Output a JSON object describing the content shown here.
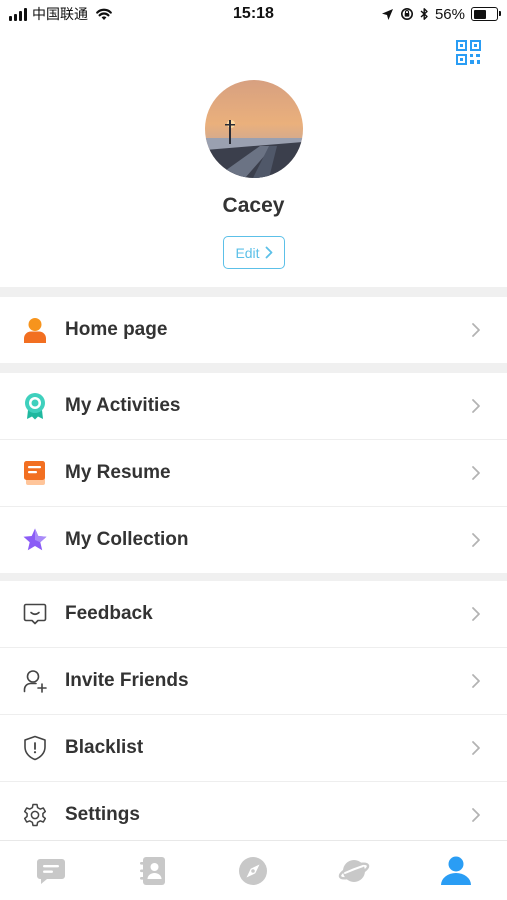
{
  "status_bar": {
    "carrier": "中国联通",
    "time": "15:18",
    "battery_percent": "56%",
    "battery_level": 0.56,
    "icons": [
      "signal-icon",
      "wifi-icon",
      "location-arrow-icon",
      "orientation-lock-icon",
      "bluetooth-icon",
      "battery-icon"
    ]
  },
  "header": {
    "qr_icon": "qr-code-icon",
    "name": "Cacey",
    "edit_label": "Edit"
  },
  "menu": {
    "group1": [
      {
        "label": "Home page",
        "icon": "person-icon",
        "color": "#f5821f"
      }
    ],
    "group2": [
      {
        "label": "My Activities",
        "icon": "medal-icon",
        "color": "#26c6b0"
      },
      {
        "label": "My Resume",
        "icon": "resume-icon",
        "color": "#f5821f"
      },
      {
        "label": "My Collection",
        "icon": "star-icon",
        "color": "#8b5cf6"
      }
    ],
    "group3": [
      {
        "label": "Feedback",
        "icon": "feedback-icon"
      },
      {
        "label": "Invite Friends",
        "icon": "add-user-icon"
      },
      {
        "label": "Blacklist",
        "icon": "shield-icon"
      },
      {
        "label": "Settings",
        "icon": "gear-icon"
      }
    ]
  },
  "tab_bar": {
    "tabs": [
      {
        "icon": "chat-icon",
        "active": false
      },
      {
        "icon": "contacts-icon",
        "active": false
      },
      {
        "icon": "compass-icon",
        "active": false
      },
      {
        "icon": "planet-icon",
        "active": false
      },
      {
        "icon": "profile-icon",
        "active": true
      }
    ],
    "active_color": "#2a9df4",
    "inactive_color": "#c8c8c8"
  },
  "colors": {
    "accent": "#5cc0e8",
    "qr": "#2a9df4",
    "text": "#333333",
    "separator": "#f0f0f0"
  }
}
